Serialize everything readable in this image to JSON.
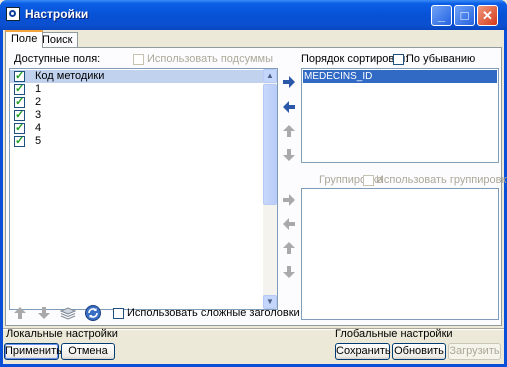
{
  "window": {
    "title": "Настройки"
  },
  "tabs": [
    {
      "label": "Поле"
    },
    {
      "label": "Поиск"
    }
  ],
  "fields": {
    "label": "Доступные поля:",
    "subtotals_label": "Использовать подсуммы",
    "items": [
      {
        "text": "Код методики",
        "checked": true
      },
      {
        "text": "1",
        "checked": true
      },
      {
        "text": "2",
        "checked": true
      },
      {
        "text": "3",
        "checked": true
      },
      {
        "text": "4",
        "checked": true
      },
      {
        "text": "5",
        "checked": true
      }
    ]
  },
  "sort": {
    "label": "Порядок сортировки:",
    "descending_label": "По убыванию",
    "items": [
      "MEDECINS_ID"
    ]
  },
  "grouping": {
    "label": "Группировка",
    "use_grouping_label": "Использовать группировку"
  },
  "toolbar": {
    "complex_headers_label": "Использовать сложные заголовки"
  },
  "local": {
    "label": "Локальные настройки",
    "apply_label": "Применить",
    "cancel_label": "Отмена"
  },
  "global": {
    "label": "Глобальные настройки",
    "save_label": "Сохранить",
    "update_label": "Обновить",
    "load_label": "Загрузить"
  },
  "colors": {
    "title_bar": "#0a5ee6",
    "selection": "#316ac5",
    "arrow_active": "#2a57a8",
    "arrow_disabled": "#a9a9a9"
  },
  "icons": [
    "app-icon",
    "minimize-icon",
    "maximize-icon",
    "close-icon",
    "arrow-right-icon",
    "arrow-left-icon",
    "arrow-up-icon",
    "arrow-down-icon",
    "layers-icon",
    "refresh-icon"
  ]
}
